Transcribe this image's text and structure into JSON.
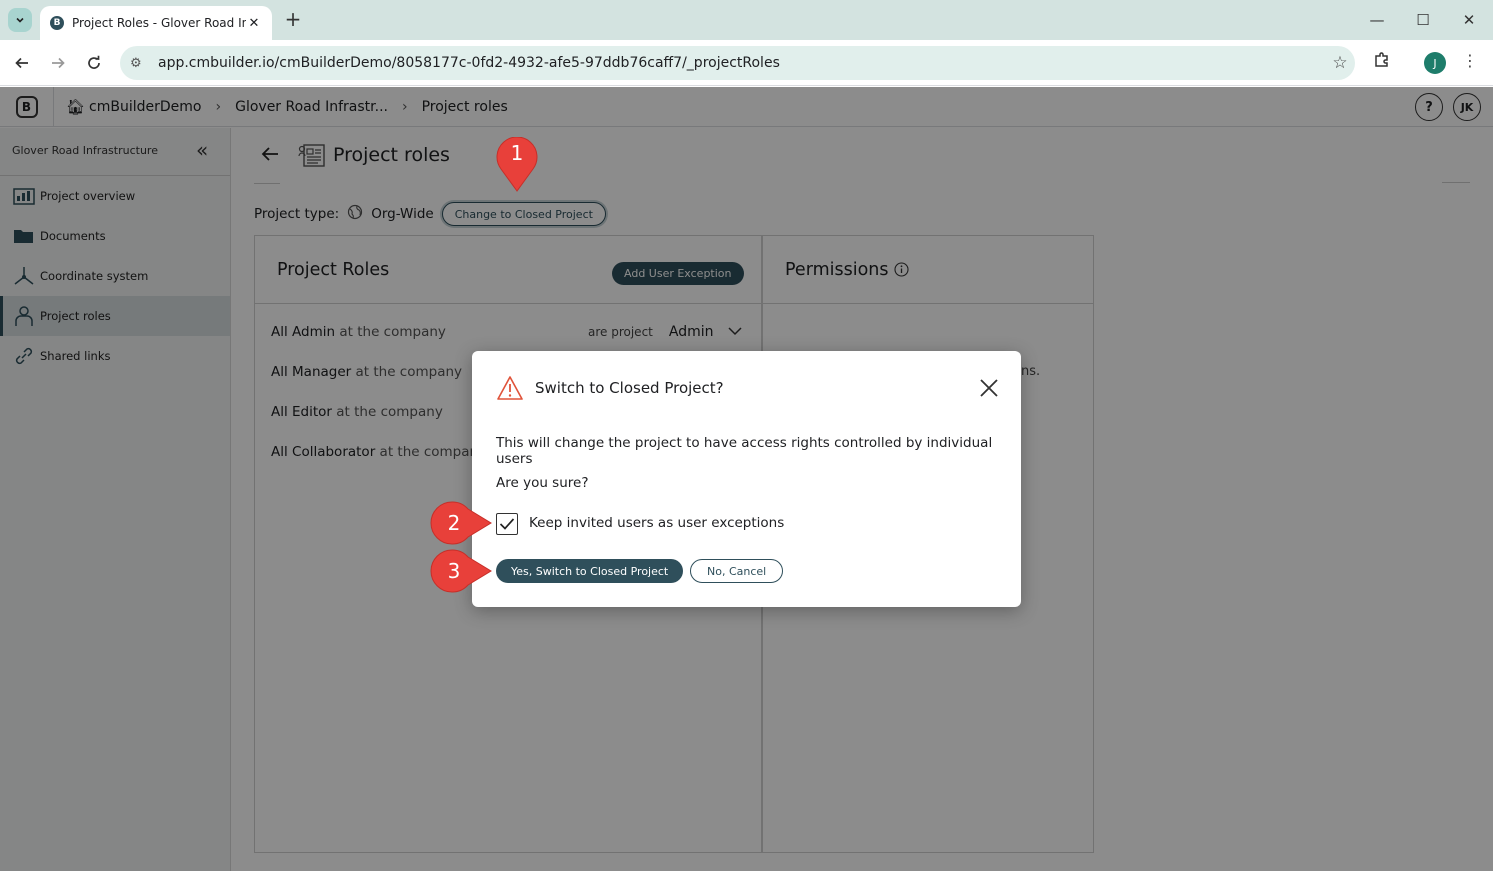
{
  "browser": {
    "tab_title": "Project Roles - Glover Road Infr",
    "tab_favicon": "B",
    "url": "app.cmbuilder.io/cmBuilderDemo/8058177c-0fd2-4932-afe5-97ddb76caff7/_projectRoles",
    "profile_initial": "J"
  },
  "app": {
    "logo": "B",
    "breadcrumb": [
      "cmBuilderDemo",
      "Glover Road Infrastr...",
      "Project roles"
    ],
    "help": "?",
    "user_initials": "JK"
  },
  "sidebar": {
    "project_name": "Glover Road Infrastructure",
    "items": [
      {
        "label": "Project overview",
        "icon": "dashboard-icon"
      },
      {
        "label": "Documents",
        "icon": "folder-icon"
      },
      {
        "label": "Coordinate system",
        "icon": "axes-icon"
      },
      {
        "label": "Project roles",
        "icon": "user-role-icon",
        "active": true
      },
      {
        "label": "Shared links",
        "icon": "link-icon"
      }
    ]
  },
  "page": {
    "title": "Project roles",
    "project_type_label": "Project type:",
    "project_type_value": "Org-Wide",
    "change_button": "Change to Closed Project"
  },
  "roles_panel": {
    "title": "Project Roles",
    "add_button": "Add User Exception",
    "rows": [
      {
        "name": "All Admin",
        "suffix": "at the company",
        "prefix": "are project",
        "role": "Admin"
      },
      {
        "name": "All Manager",
        "suffix": "at the company"
      },
      {
        "name": "All Editor",
        "suffix": "at the company"
      },
      {
        "name": "All Collaborator",
        "suffix": "at the company"
      }
    ]
  },
  "permissions_panel": {
    "title": "Permissions",
    "partial_text": "ons."
  },
  "dialog": {
    "title": "Switch to Closed Project?",
    "body": "This will change the project to have access rights controlled by individual users",
    "confirm_question": "Are you sure?",
    "checkbox_label": "Keep invited users as user exceptions",
    "checkbox_checked": true,
    "yes_button": "Yes, Switch to Closed Project",
    "no_button": "No, Cancel"
  },
  "callouts": [
    "1",
    "2",
    "3"
  ],
  "colors": {
    "accent": "#2f4f5b",
    "callout": "#e8403a",
    "warning": "#e0533a"
  }
}
